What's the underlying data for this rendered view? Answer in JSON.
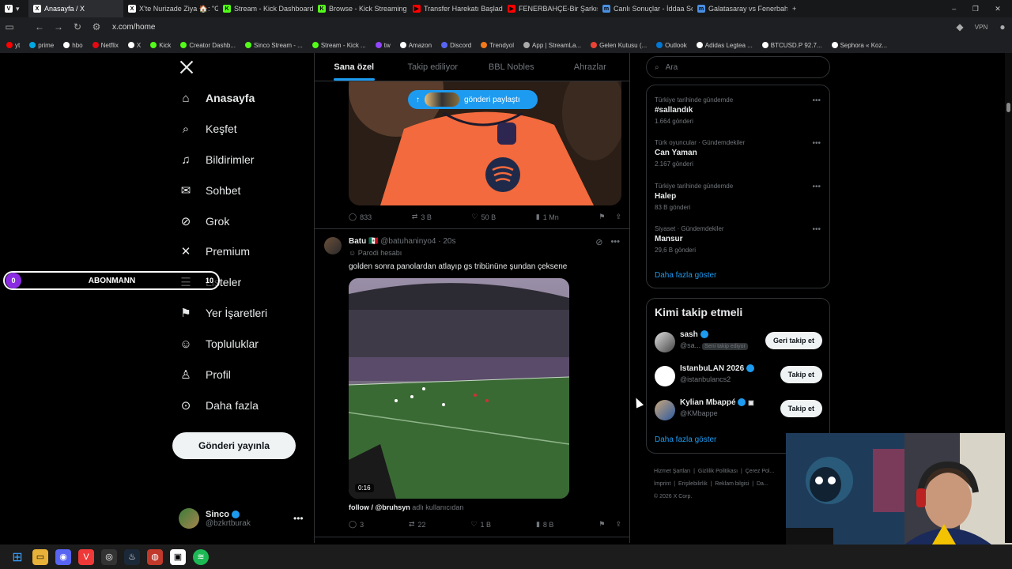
{
  "browser": {
    "tabs": [
      {
        "label": "Anasayfa / X",
        "icon": "x-logo-icon",
        "color": "#ffffff"
      },
      {
        "label": "X'te Nurizade Ziya 🏠: \"Gala...",
        "icon": "x-logo-icon",
        "color": "#ffffff"
      },
      {
        "label": "Stream - Kick Dashboard",
        "icon": "kick-icon",
        "color": "#53fc18"
      },
      {
        "label": "Browse - Kick Streaming",
        "icon": "kick-icon",
        "color": "#53fc18"
      },
      {
        "label": "Transfer Harekatı Başladı | F...",
        "icon": "youtube-icon",
        "color": "#ff0000"
      },
      {
        "label": "FENERBAHÇE-Bir Şarkısın S...",
        "icon": "youtube-icon",
        "color": "#ff0000"
      },
      {
        "label": "Canlı Sonuçlar - İddaa Sonu...",
        "icon": "m-icon",
        "color": "#4a90e2"
      },
      {
        "label": "Galatasaray vs Fenerbahçe...",
        "icon": "m-icon",
        "color": "#4a90e2"
      }
    ],
    "url": "x.com/home",
    "bookmarks": [
      "yt",
      "prime",
      "hbo",
      "Netflix",
      "X",
      "Kick",
      "Creator Dashb...",
      "Sinco Stream - ...",
      "Stream - Kick ...",
      "tw",
      "Amazon",
      "Discord",
      "Trendyol",
      "App | StreamLa...",
      "Gelen Kutusu (...",
      "Outlook",
      "Adidas Legtea ...",
      "BTCUSD.P 92.7...",
      "Sephora « Koz..."
    ]
  },
  "nav": {
    "items": [
      {
        "label": "Anasayfa",
        "icon": "home-icon"
      },
      {
        "label": "Keşfet",
        "icon": "search-icon"
      },
      {
        "label": "Bildirimler",
        "icon": "bell-icon"
      },
      {
        "label": "Sohbet",
        "icon": "mail-icon"
      },
      {
        "label": "Grok",
        "icon": "grok-icon"
      },
      {
        "label": "Premium",
        "icon": "x-logo-icon"
      },
      {
        "label": "Listeler",
        "icon": "list-icon"
      },
      {
        "label": "Yer İşaretleri",
        "icon": "bookmark-icon"
      },
      {
        "label": "Topluluklar",
        "icon": "people-icon"
      },
      {
        "label": "Profil",
        "icon": "person-icon"
      },
      {
        "label": "Daha fazla",
        "icon": "more-circle-icon"
      }
    ],
    "post_button": "Gönderi yayınla",
    "user": {
      "name": "Sinco",
      "handle": "@bzkrtburak"
    }
  },
  "overlay": {
    "count": "0",
    "label": "ABONMANN",
    "goal": "10"
  },
  "main": {
    "tabs": [
      "Sana özel",
      "Takip ediliyor",
      "BBL Nobles",
      "Ahrazlar"
    ],
    "share_pill": "gönderi paylaştı",
    "tweet1_actions": {
      "replies": "833",
      "reposts": "3 B",
      "likes": "50 B",
      "views": "1 Mn"
    },
    "tweet2": {
      "name": "Batu",
      "handle": "@batuhaninyo4",
      "time": "20s",
      "parody": "Parodi hesabı",
      "text": "golden sonra panolardan atlayıp gs tribününe şundan çeksene",
      "duration": "0:16",
      "caption_user": "follow / @bruhsyn",
      "caption_suffix": "adlı kullanıcıdan",
      "actions": {
        "replies": "3",
        "reposts": "22",
        "likes": "1 B",
        "views": "8 B"
      }
    }
  },
  "right": {
    "search_placeholder": "Ara",
    "trends": [
      {
        "context": "Türkiye tarihinde gündemde",
        "title": "#sallandık",
        "count": "1.664 gönderi"
      },
      {
        "context": "Türk oyuncular · Gündemdekiler",
        "title": "Can Yaman",
        "count": "2.167 gönderi"
      },
      {
        "context": "Türkiye tarihinde gündemde",
        "title": "Halep",
        "count": "83 B gönderi"
      },
      {
        "context": "Siyaset · Gündemdekiler",
        "title": "Mansur",
        "count": "29,6 B gönderi"
      }
    ],
    "trends_more": "Daha fazla göster",
    "who_to_follow": {
      "title": "Kimi takip etmeli",
      "accounts": [
        {
          "name": "sash",
          "handle": "@sa...",
          "badge": "Seni takip ediyor",
          "button": "Geri takip et"
        },
        {
          "name": "IstanbuLAN 2026",
          "handle": "@istanbulancs2",
          "badge": "",
          "button": "Takip et"
        },
        {
          "name": "Kylian Mbappé",
          "handle": "@KMbappe",
          "badge": "",
          "button": "Takip et"
        }
      ],
      "more": "Daha fazla göster"
    },
    "footer": [
      "Hizmet Şartları",
      "Gizlilik Politikası",
      "Çerez Pol...",
      "İmprint",
      "Erişilebilirlik",
      "Reklam bilgisi",
      "Da...",
      "© 2026 X Corp."
    ]
  },
  "colors": {
    "accent": "#1d9bf0",
    "background": "#000000",
    "border": "#2f3336"
  }
}
